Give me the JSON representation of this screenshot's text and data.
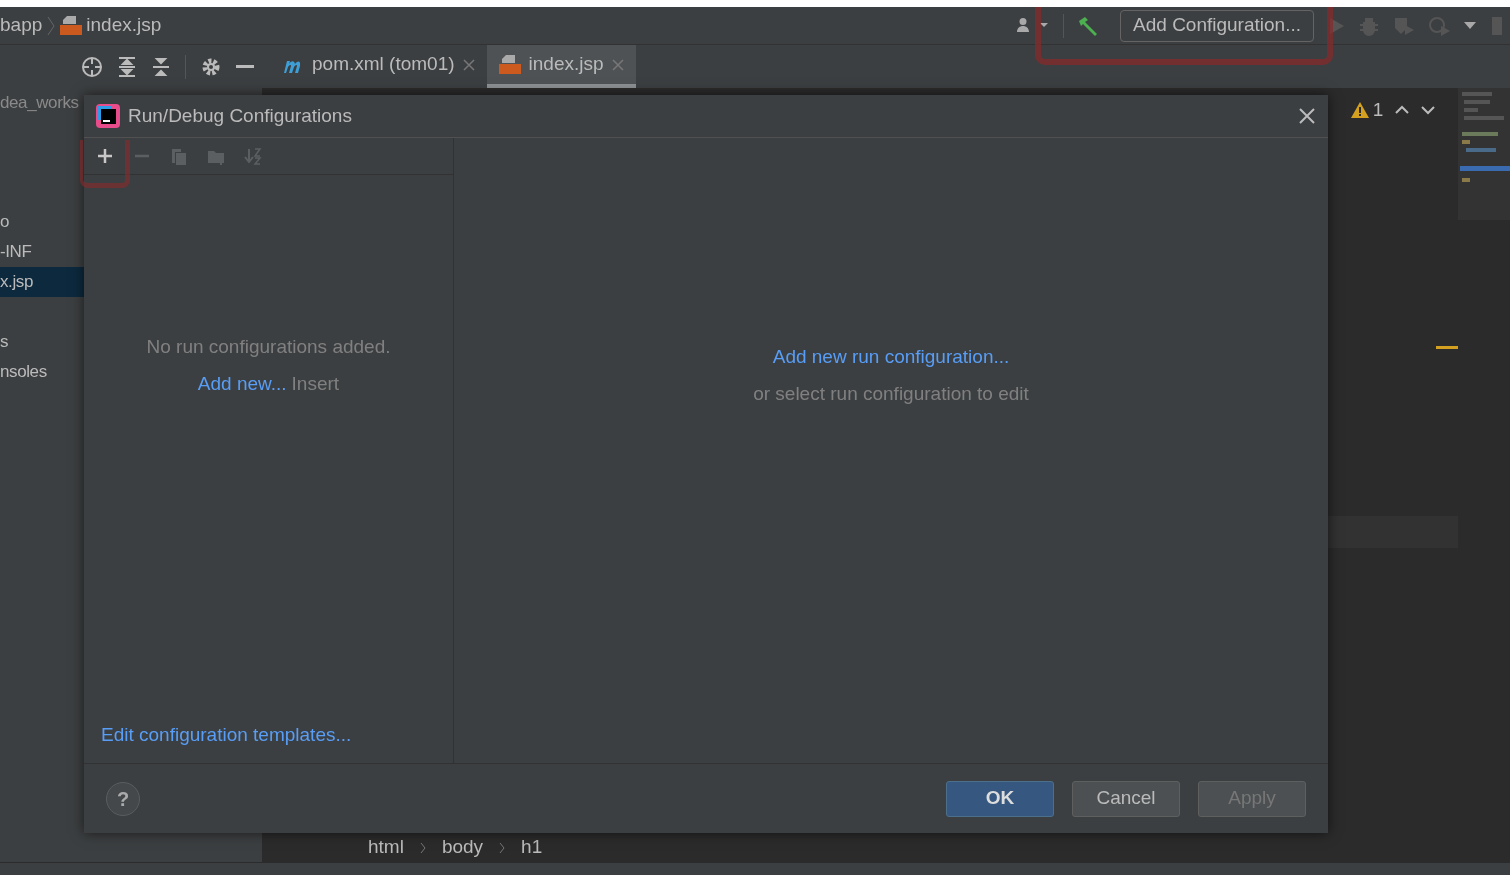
{
  "breadcrumb": {
    "items": [
      {
        "label": "bapp",
        "kind": "folder"
      },
      {
        "label": "index.jsp",
        "kind": "jsp"
      }
    ]
  },
  "main_toolbar": {
    "config_button": "Add Configuration..."
  },
  "editor_tabs": [
    {
      "label": "pom.xml (tom01)",
      "kind": "maven",
      "selected": false
    },
    {
      "label": "index.jsp",
      "kind": "jsp",
      "selected": true
    }
  ],
  "project_tree": {
    "items": [
      {
        "label": "dea_works",
        "selected": false
      },
      {
        "label": "o",
        "selected": false
      },
      {
        "label": "-INF",
        "selected": false
      },
      {
        "label": "x.jsp",
        "selected": true
      },
      {
        "label": "s",
        "selected": false
      },
      {
        "label": "nsoles",
        "selected": false
      }
    ]
  },
  "editor": {
    "warning_count": "1",
    "path": [
      "html",
      "body",
      "h1"
    ]
  },
  "dialog": {
    "title": "Run/Debug Configurations",
    "actions": [
      {
        "kind": "add",
        "disabled": false
      },
      {
        "kind": "remove",
        "disabled": true
      },
      {
        "kind": "copy",
        "disabled": true
      },
      {
        "kind": "folder",
        "disabled": true
      },
      {
        "kind": "sort",
        "disabled": true
      }
    ],
    "empty_message": "No run configurations added.",
    "add_link": "Add new...",
    "add_shortcut": "Insert",
    "templates_link": "Edit configuration templates...",
    "right_link": "Add new run configuration...",
    "right_hint": "or select run configuration to edit",
    "help": "?",
    "buttons": [
      {
        "label": "OK",
        "kind": "primary",
        "disabled": false
      },
      {
        "label": "Cancel",
        "kind": "normal",
        "disabled": false
      },
      {
        "label": "Apply",
        "kind": "normal",
        "disabled": true
      }
    ]
  }
}
